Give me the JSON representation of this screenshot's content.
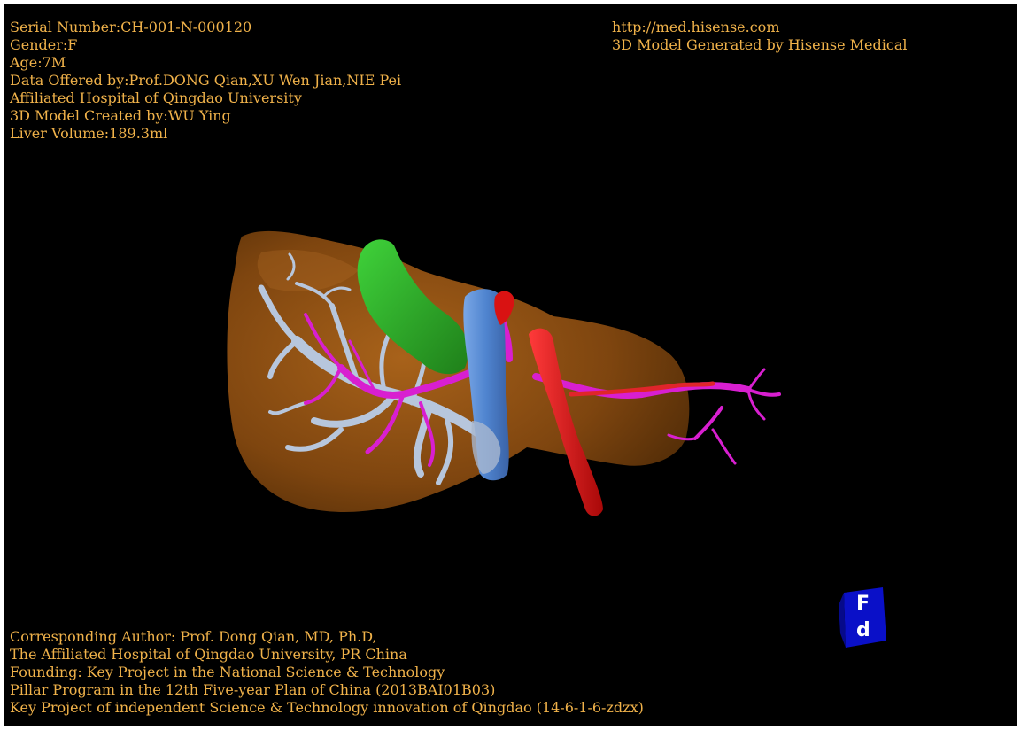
{
  "header_left": {
    "serial": "Serial Number:CH-001-N-000120",
    "gender": "Gender:F",
    "age": "Age:7M",
    "data_offered": "Data Offered by:Prof.DONG Qian,XU Wen Jian,NIE Pei",
    "hospital": "Affiliated Hospital of Qingdao University",
    "model_created": "3D Model Created by:WU Ying",
    "liver_volume": "Liver Volume:189.3ml"
  },
  "header_right": {
    "url": "http://med.hisense.com",
    "generated_by": "3D Model Generated by Hisense Medical"
  },
  "footer": {
    "line1": "Corresponding Author: Prof. Dong Qian, MD, Ph.D,",
    "line2": "The Affiliated Hospital of Qingdao University, PR China",
    "line3": "Founding: Key Project in the National Science & Technology",
    "line4": "Pillar Program in the 12th Five-year Plan of China (2013BAI01B03)",
    "line5": "Key Project of independent Science & Technology innovation of Qingdao (14-6-1-6-zdzx)"
  },
  "orientation_cube": {
    "top_label": "F",
    "bottom_label": "d",
    "color": "#0a10c8"
  },
  "colors": {
    "text": "#f0b24a",
    "liver": "#8a4e12",
    "gallbladder": "#2fb52a",
    "portal_vein": "#5a8fd6",
    "hepatic_vein": "#b7c6dc",
    "artery": "#d91212",
    "bile_duct": "#d81fd0",
    "background": "#000000"
  }
}
